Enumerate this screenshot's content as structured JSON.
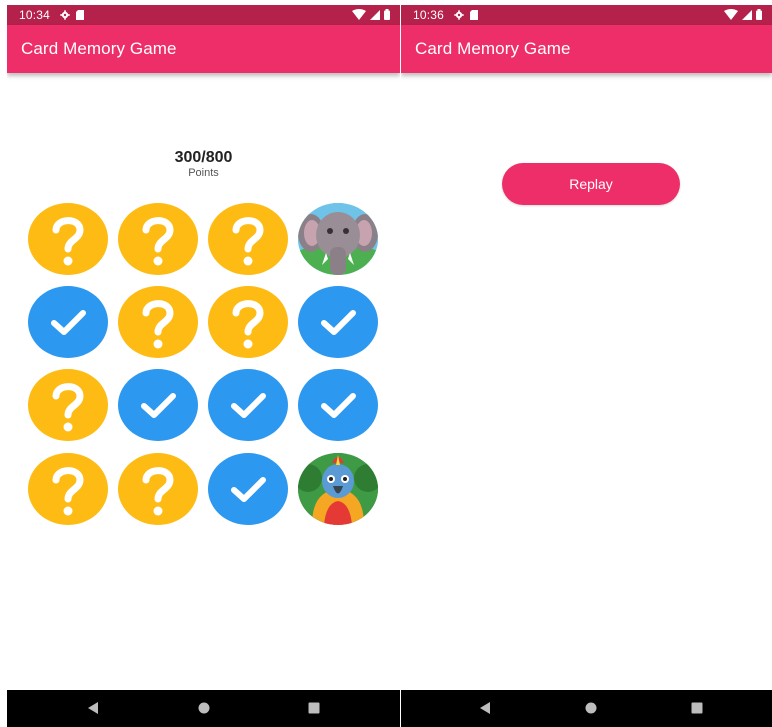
{
  "colors": {
    "status_bar": "#b4214a",
    "app_bar": "#ee2e69",
    "card_hidden": "#fdbb13",
    "card_matched": "#2d98f0",
    "replay_button": "#ee2e69",
    "nav_bar": "#000000"
  },
  "screens": [
    {
      "status_bar": {
        "time": "10:34",
        "icons": [
          "gear-icon",
          "sd-card-icon",
          "wifi-icon",
          "signal-icon",
          "battery-icon"
        ]
      },
      "app_bar": {
        "title": "Card Memory Game"
      },
      "score": {
        "value": "300/800",
        "label": "Points"
      },
      "cards": [
        {
          "state": "hidden",
          "icon": "question-mark-icon"
        },
        {
          "state": "hidden",
          "icon": "question-mark-icon"
        },
        {
          "state": "hidden",
          "icon": "question-mark-icon"
        },
        {
          "state": "revealed",
          "icon": "elephant-icon"
        },
        {
          "state": "matched",
          "icon": "checkmark-icon"
        },
        {
          "state": "hidden",
          "icon": "question-mark-icon"
        },
        {
          "state": "hidden",
          "icon": "question-mark-icon"
        },
        {
          "state": "matched",
          "icon": "checkmark-icon"
        },
        {
          "state": "hidden",
          "icon": "question-mark-icon"
        },
        {
          "state": "matched",
          "icon": "checkmark-icon"
        },
        {
          "state": "matched",
          "icon": "checkmark-icon"
        },
        {
          "state": "matched",
          "icon": "checkmark-icon"
        },
        {
          "state": "hidden",
          "icon": "question-mark-icon"
        },
        {
          "state": "hidden",
          "icon": "question-mark-icon"
        },
        {
          "state": "matched",
          "icon": "checkmark-icon"
        },
        {
          "state": "revealed",
          "icon": "parrot-icon"
        }
      ],
      "nav_bar": {
        "icons": [
          "back-icon",
          "home-icon",
          "recents-icon"
        ]
      }
    },
    {
      "status_bar": {
        "time": "10:36",
        "icons": [
          "gear-icon",
          "sd-card-icon",
          "wifi-icon",
          "signal-icon",
          "battery-icon"
        ]
      },
      "app_bar": {
        "title": "Card Memory Game"
      },
      "replay": {
        "label": "Replay"
      },
      "nav_bar": {
        "icons": [
          "back-icon",
          "home-icon",
          "recents-icon"
        ]
      }
    }
  ]
}
